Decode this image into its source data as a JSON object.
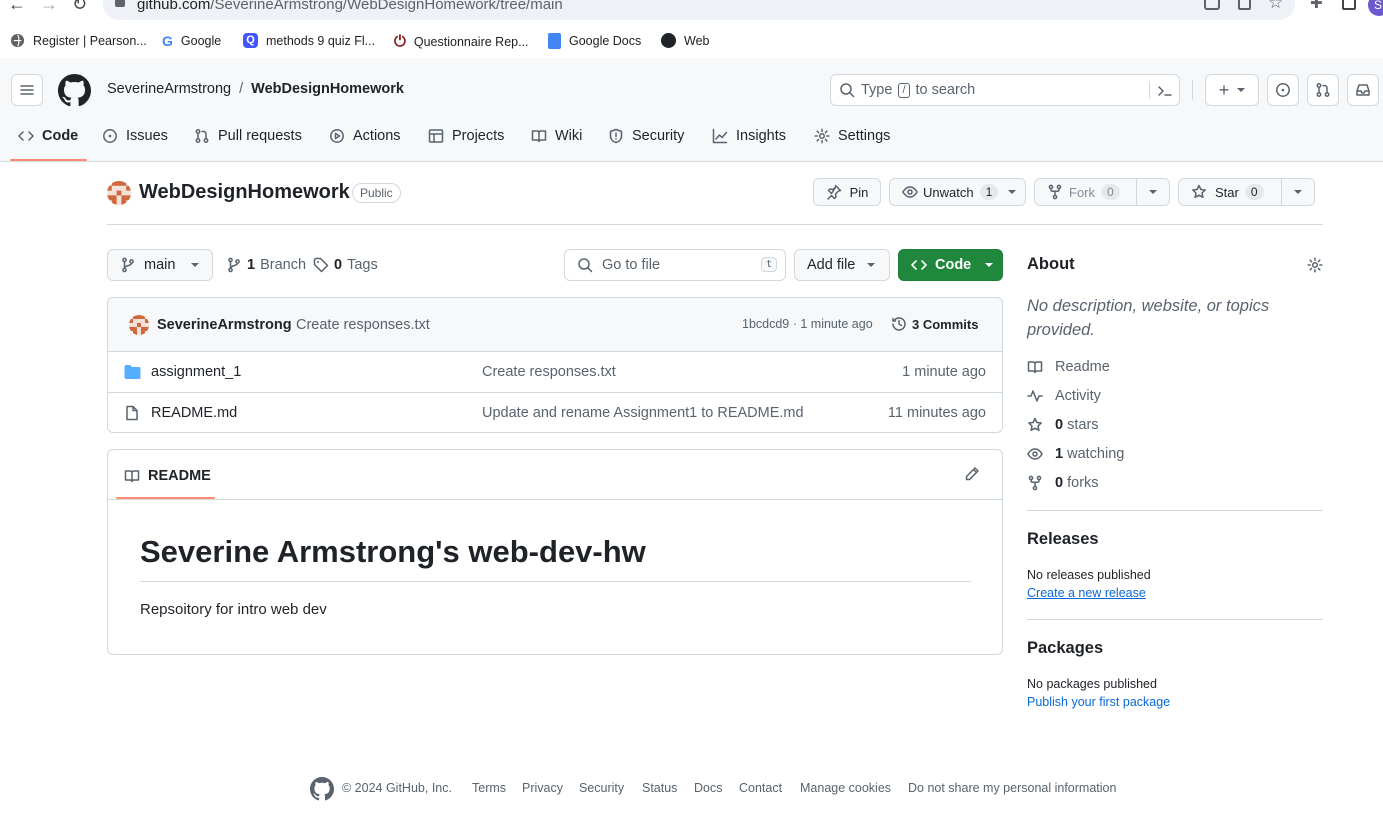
{
  "browser": {
    "url_host": "github.com",
    "url_path": "/SeverineArmstrong/WebDesignHomework/tree/main",
    "profile_initial": "S",
    "bookmarks": [
      {
        "label": "Register | Pearson..."
      },
      {
        "label": "Google"
      },
      {
        "label": "methods 9 quiz Fl..."
      },
      {
        "label": "Questionnaire Rep..."
      },
      {
        "label": "Google Docs"
      },
      {
        "label": "Web"
      }
    ]
  },
  "header": {
    "owner": "SeverineArmstrong",
    "separator": "/",
    "repo": "WebDesignHomework",
    "search_prefix": "Type",
    "search_key": "/",
    "search_suffix": "to search",
    "plus_label": "+"
  },
  "tabs": [
    {
      "label": "Code",
      "active": true
    },
    {
      "label": "Issues"
    },
    {
      "label": "Pull requests"
    },
    {
      "label": "Actions"
    },
    {
      "label": "Projects"
    },
    {
      "label": "Wiki"
    },
    {
      "label": "Security"
    },
    {
      "label": "Insights"
    },
    {
      "label": "Settings"
    }
  ],
  "repo": {
    "title": "WebDesignHomework",
    "visibility": "Public",
    "pin_label": "Pin",
    "unwatch_label": "Unwatch",
    "watch_count": "1",
    "fork_label": "Fork",
    "fork_count": "0",
    "star_label": "Star",
    "star_count": "0"
  },
  "toolbar": {
    "branch": "main",
    "branch_count": "1",
    "branch_label": "Branch",
    "tag_count": "0",
    "tag_label": "Tags",
    "goto_placeholder": "Go to file",
    "goto_key": "t",
    "add_file_label": "Add file",
    "code_label": "Code"
  },
  "commit": {
    "author": "SeverineArmstrong",
    "message": "Create responses.txt",
    "sha_time": "1bcdcd9 · 1 minute ago",
    "commits_label": "3 Commits"
  },
  "files": [
    {
      "type": "folder",
      "name": "assignment_1",
      "message": "Create responses.txt",
      "time": "1 minute ago"
    },
    {
      "type": "file",
      "name": "README.md",
      "message": "Update and rename Assignment1 to README.md",
      "time": "11 minutes ago"
    }
  ],
  "readme": {
    "tab_label": "README",
    "heading": "Severine Armstrong's web-dev-hw",
    "body": "Repsoitory for intro web dev"
  },
  "about": {
    "title": "About",
    "description": "No description, website, or topics provided.",
    "readme": "Readme",
    "activity": "Activity",
    "stars_count": "0",
    "stars_label": "stars",
    "watching_count": "1",
    "watching_label": "watching",
    "forks_count": "0",
    "forks_label": "forks"
  },
  "releases": {
    "title": "Releases",
    "empty": "No releases published",
    "link": "Create a new release"
  },
  "packages": {
    "title": "Packages",
    "empty": "No packages published",
    "link": "Publish your first package"
  },
  "footer": {
    "copyright": "© 2024 GitHub, Inc.",
    "links": [
      "Terms",
      "Privacy",
      "Security",
      "Status",
      "Docs",
      "Contact",
      "Manage cookies",
      "Do not share my personal information"
    ]
  },
  "colors": {
    "accent_green": "#1f883d",
    "link_blue": "#0969da",
    "tab_underline": "#fd8c73",
    "folder_blue": "#54aeff"
  }
}
